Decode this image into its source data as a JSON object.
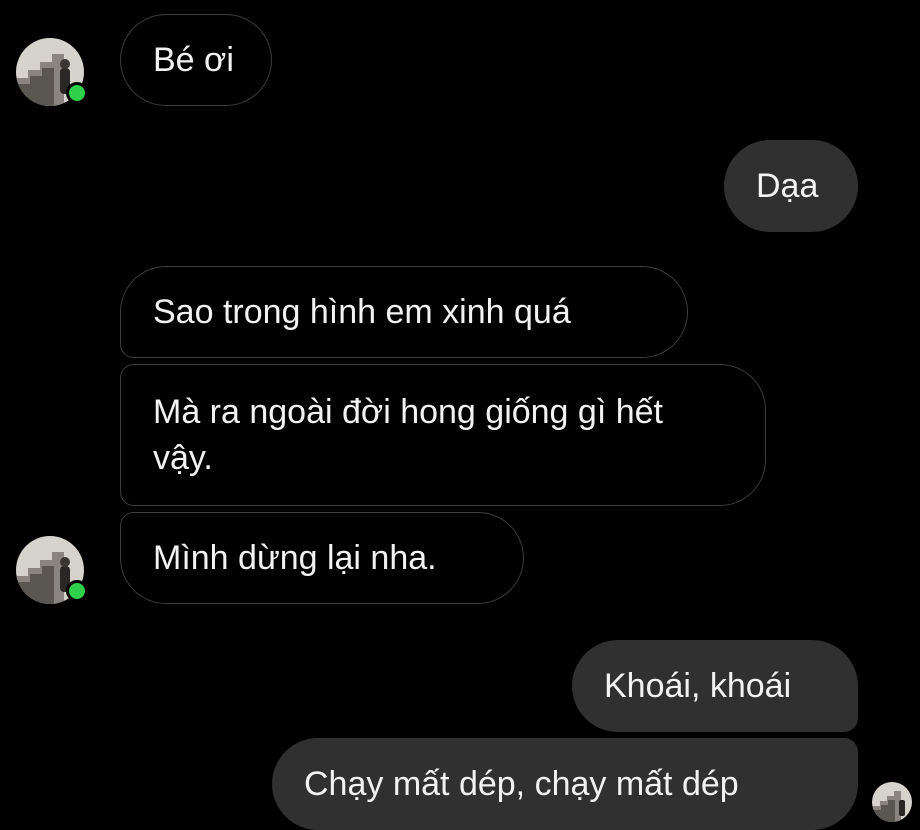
{
  "messages": [
    {
      "sender": "them",
      "text": "Bé ơi"
    },
    {
      "sender": "me",
      "text": "Dạa"
    },
    {
      "sender": "them",
      "text": "Sao trong hình em xinh quá"
    },
    {
      "sender": "them",
      "text": "Mà ra ngoài đời hong giống gì hết vậy."
    },
    {
      "sender": "them",
      "text": "Mình dừng lại nha."
    },
    {
      "sender": "me",
      "text": "Khoái, khoái"
    },
    {
      "sender": "me",
      "text": "Chạy mất dép, chạy mất dép"
    }
  ],
  "colors": {
    "background": "#000000",
    "incoming_border": "#3d3d3d",
    "outgoing_bubble": "#303030",
    "text": "#f2f2f2",
    "online_dot": "#2fd14b"
  },
  "icons": {
    "contact_avatar": "contact-avatar-stairs-photo",
    "online_indicator": "online-dot",
    "seen_avatar": "seen-avatar"
  }
}
